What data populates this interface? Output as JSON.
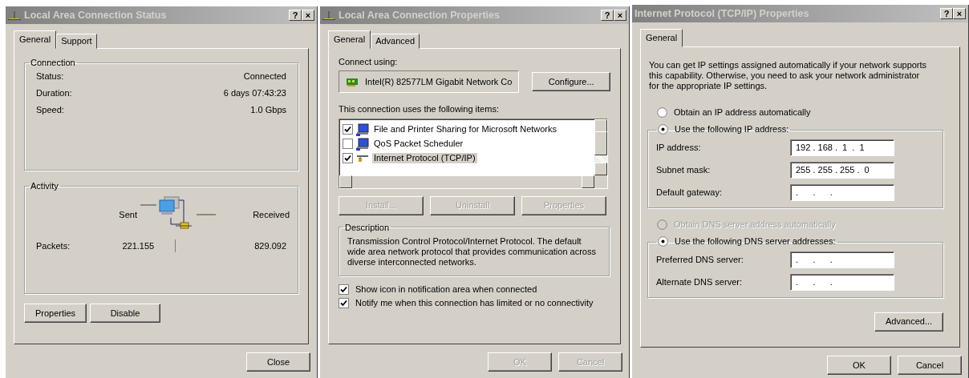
{
  "windows": [
    {
      "kind": "status",
      "title": "Local Area Connection Status",
      "title_icon": true,
      "controls": [
        "?",
        "×"
      ],
      "tabs": [
        {
          "label": "General",
          "selected": true
        },
        {
          "label": "Support",
          "selected": false
        }
      ],
      "connection": {
        "legend": "Connection",
        "rows": [
          {
            "label": "Status:",
            "value": "Connected"
          },
          {
            "label": "Duration:",
            "value": "6 days 07:43:23"
          },
          {
            "label": "Speed:",
            "value": "1.0 Gbps"
          }
        ]
      },
      "activity": {
        "legend": "Activity",
        "sent_label": "Sent",
        "received_label": "Received",
        "packets_label": "Packets:",
        "sent": "221.155",
        "received": "829.092"
      },
      "buttons": [
        {
          "label": "Properties",
          "disabled": false
        },
        {
          "label": "Disable",
          "disabled": false
        }
      ],
      "footer_buttons": [
        {
          "label": "Close",
          "disabled": false
        }
      ]
    },
    {
      "kind": "properties",
      "title": "Local Area Connection Properties",
      "title_icon": true,
      "controls": [
        "?",
        "×"
      ],
      "tabs": [
        {
          "label": "General",
          "selected": true
        },
        {
          "label": "Advanced",
          "selected": false
        }
      ],
      "connect_using_label": "Connect using:",
      "adapter": "Intel(R) 82577LM Gigabit Network Co",
      "configure_button": "Configure...",
      "items_label": "This connection uses the following items:",
      "items": [
        {
          "label": "File and Printer Sharing for Microsoft Networks",
          "kind": "service",
          "checked": true,
          "selected": false
        },
        {
          "label": "QoS Packet Scheduler",
          "kind": "service",
          "checked": false,
          "selected": false
        },
        {
          "label": "Internet Protocol (TCP/IP)",
          "kind": "protocol",
          "checked": true,
          "selected": true
        }
      ],
      "buttons": [
        {
          "label": "Install...",
          "disabled": true
        },
        {
          "label": "Uninstall",
          "disabled": true
        },
        {
          "label": "Properties",
          "disabled": true
        }
      ],
      "description": {
        "legend": "Description",
        "text": "Transmission Control Protocol/Internet Protocol. The default wide area network protocol that provides communication across diverse interconnected networks."
      },
      "options": [
        {
          "label": "Show icon in notification area when connected",
          "checked": true
        },
        {
          "label": "Notify me when this connection has limited or no connectivity",
          "checked": true
        }
      ],
      "footer_buttons": [
        {
          "label": "OK",
          "disabled": true
        },
        {
          "label": "Cancel",
          "disabled": true
        }
      ]
    },
    {
      "kind": "tcpip",
      "title": "Internet Protocol (TCP/IP) Properties",
      "title_icon": false,
      "controls": [
        "?",
        "×"
      ],
      "tabs": [
        {
          "label": "General",
          "selected": true
        }
      ],
      "intro": "You can get IP settings assigned automatically if your network supports this capability. Otherwise, you need to ask your network administrator for the appropriate IP settings.",
      "ip_options": [
        {
          "label": "Obtain an IP address automatically",
          "selected": false,
          "disabled": false
        },
        {
          "label": "Use the following IP address:",
          "selected": true,
          "disabled": false
        }
      ],
      "ip_fields": [
        {
          "label": "IP address:",
          "value": "192 . 168 .  1  .  1"
        },
        {
          "label": "Subnet mask:",
          "value": "255 . 255 . 255 .  0"
        },
        {
          "label": "Default gateway:",
          "value": ".      .      ."
        }
      ],
      "dns_options": [
        {
          "label": "Obtain DNS server address automatically",
          "selected": false,
          "disabled": true
        },
        {
          "label": "Use the following DNS server addresses:",
          "selected": true,
          "disabled": false
        }
      ],
      "dns_fields": [
        {
          "label": "Preferred DNS server:",
          "value": ".      .      ."
        },
        {
          "label": "Alternate DNS server:",
          "value": ".      .      ."
        }
      ],
      "advanced_button": "Advanced...",
      "footer_buttons": [
        {
          "label": "OK",
          "disabled": false
        },
        {
          "label": "Cancel",
          "disabled": false
        }
      ]
    }
  ]
}
